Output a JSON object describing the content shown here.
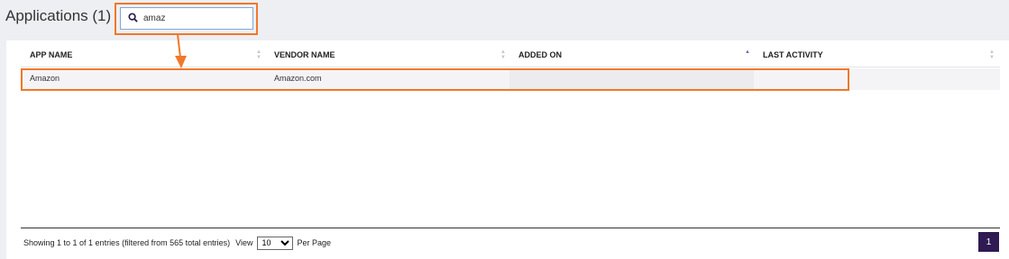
{
  "page": {
    "title": "Applications (1)"
  },
  "search": {
    "value": "amaz",
    "icon": "search-icon"
  },
  "table": {
    "columns": [
      {
        "label": "APP NAME",
        "sort": "none"
      },
      {
        "label": "VENDOR NAME",
        "sort": "none"
      },
      {
        "label": "ADDED ON",
        "sort": "ascending"
      },
      {
        "label": "LAST ACTIVITY",
        "sort": "none"
      }
    ],
    "rows": [
      {
        "app_name": "Amazon",
        "vendor_name": "Amazon.com",
        "added_on": "",
        "last_activity": ""
      }
    ]
  },
  "footer": {
    "showing_text": "Showing 1 to 1 of 1 entries (filtered from 565 total entries)",
    "view_label": "View",
    "per_page_value": "10",
    "per_page_label": "Per Page",
    "current_page": "1"
  },
  "colors": {
    "highlight": "#f0782a",
    "page_button": "#2f1a52",
    "background": "#eeeff3"
  }
}
